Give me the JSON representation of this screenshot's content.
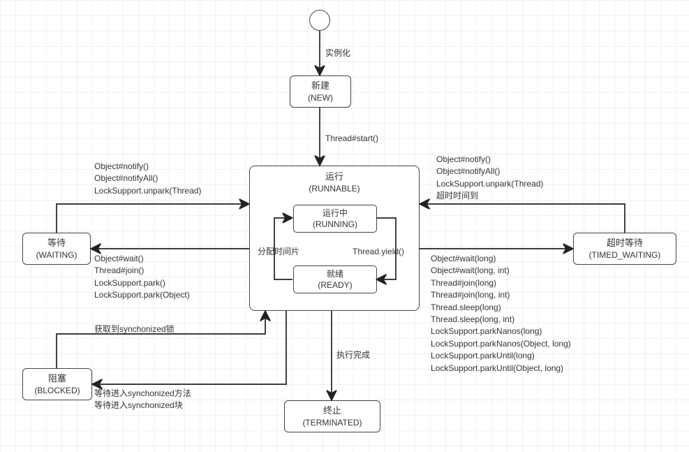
{
  "nodes": {
    "new": {
      "cn": "新建",
      "en": "(NEW)"
    },
    "runnable": {
      "cn": "运行",
      "en": "(RUNNABLE)"
    },
    "running": {
      "cn": "运行中",
      "en": "(RUNNING)"
    },
    "ready": {
      "cn": "就绪",
      "en": "(READY)"
    },
    "waiting": {
      "cn": "等待",
      "en": "(WAITING)"
    },
    "timed": {
      "cn": "超时等待",
      "en": "(TIMED_WAITING)"
    },
    "blocked": {
      "cn": "阻塞",
      "en": "(BLOCKED)"
    },
    "terminated": {
      "cn": "终止",
      "en": "(TERMINATED)"
    }
  },
  "labels": {
    "instantiate": "实例化",
    "thread_start": "Thread#start()",
    "to_waiting": "Object#wait()\nThread#join()\nLockSupport.park()\nLockSupport.park(Object)",
    "from_waiting": "Object#notify()\nObject#notifyAll()\nLockSupport.unpark(Thread)",
    "to_timed": "Object#wait(long)\nObject#wait(long, int)\nThread#join(long)\nThread#join(long, int)\nThread.sleep(long)\nThread.sleep(long, int)\nLockSupport.parkNanos(long)\nLockSupport.parkNanos(Object, long)\nLockSupport.parkUntil(long)\nLockSupport.parkUntil(Object, long)",
    "from_timed": "Object#notify()\nObject#notifyAll()\nLockSupport.unpark(Thread)\n超时时间到",
    "to_blocked": "等待进入synchonized方法\n等待进入synchonized块",
    "from_blocked": "获取到synchonized锁",
    "to_terminated": "执行完成",
    "alloc_slice": "分配时间片",
    "yield": "Thread.yield()"
  }
}
